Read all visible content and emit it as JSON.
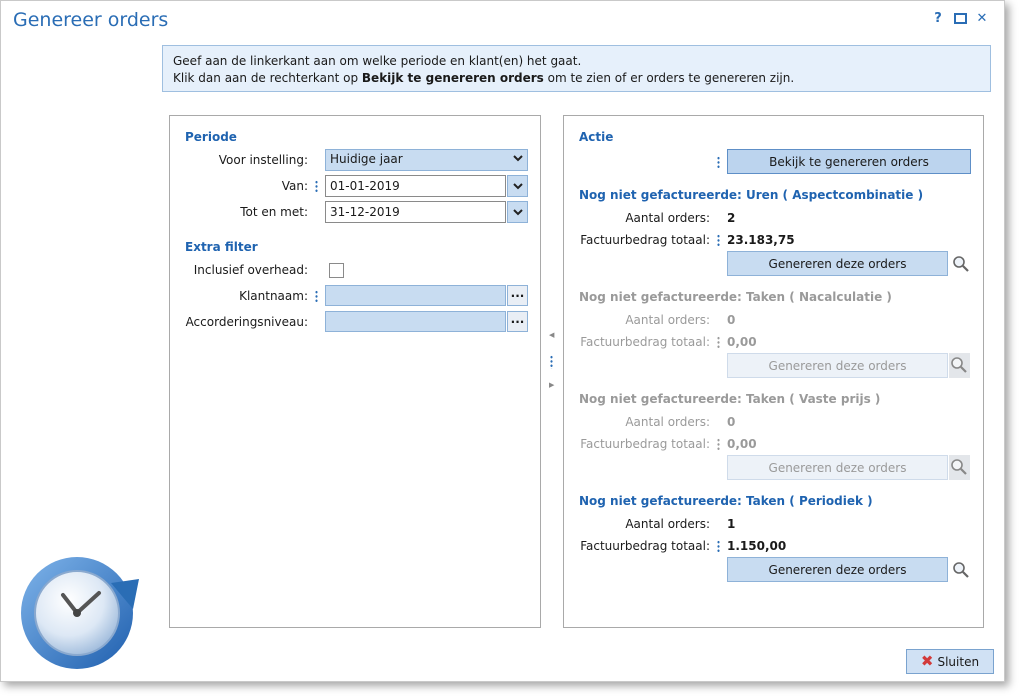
{
  "window": {
    "title": "Genereer orders",
    "help_label": "?",
    "close_label": "✕"
  },
  "info": {
    "line1": "Geef aan de linkerkant aan om welke periode en klant(en) het gaat.",
    "line2_pre": "Klik dan aan de rechterkant op ",
    "line2_bold": "Bekijk te genereren orders",
    "line2_post": " om te zien of er orders te genereren zijn."
  },
  "left": {
    "periode_title": "Periode",
    "voor_instelling_label": "Voor instelling:",
    "voor_instelling_value": "Huidige jaar",
    "van_label": "Van:",
    "van_value": "01-01-2019",
    "tot_label": "Tot en met:",
    "tot_value": "31-12-2019",
    "extra_filter_title": "Extra filter",
    "inclusief_label": "Inclusief overhead:",
    "klantnaam_label": "Klantnaam:",
    "accordering_label": "Accorderingsniveau:",
    "lookup_button": "···"
  },
  "right": {
    "actie_title": "Actie",
    "bekijk_button": "Bekijk te genereren orders",
    "sections": [
      {
        "title": "Nog niet gefactureerde: Uren ( Aspectcombinatie )",
        "orders_label": "Aantal orders:",
        "orders": "2",
        "bedrag_label": "Factuurbedrag totaal:",
        "bedrag": "23.183,75",
        "button": "Genereren deze orders",
        "enabled": true
      },
      {
        "title": "Nog niet gefactureerde: Taken ( Nacalculatie )",
        "orders_label": "Aantal orders:",
        "orders": "0",
        "bedrag_label": "Factuurbedrag totaal:",
        "bedrag": "0,00",
        "button": "Genereren deze orders",
        "enabled": false
      },
      {
        "title": "Nog niet gefactureerde: Taken ( Vaste prijs )",
        "orders_label": "Aantal orders:",
        "orders": "0",
        "bedrag_label": "Factuurbedrag totaal:",
        "bedrag": "0,00",
        "button": "Genereren deze orders",
        "enabled": false
      },
      {
        "title": "Nog niet gefactureerde: Taken ( Periodiek )",
        "orders_label": "Aantal orders:",
        "orders": "1",
        "bedrag_label": "Factuurbedrag totaal:",
        "bedrag": "1.150,00",
        "button": "Genereren deze orders",
        "enabled": true
      }
    ]
  },
  "footer": {
    "sluiten_label": "Sluiten"
  },
  "colors": {
    "accent": "#2a6db5",
    "field_bg": "#c8dcf1",
    "info_bg": "#e6f0fb",
    "disabled_text": "#9a9a9a",
    "close_icon": "#d23a3a"
  },
  "icons": [
    "help-icon",
    "maximize-icon",
    "close-icon",
    "chevron-down-icon",
    "magnifier-icon",
    "clock-refresh-icon"
  ]
}
